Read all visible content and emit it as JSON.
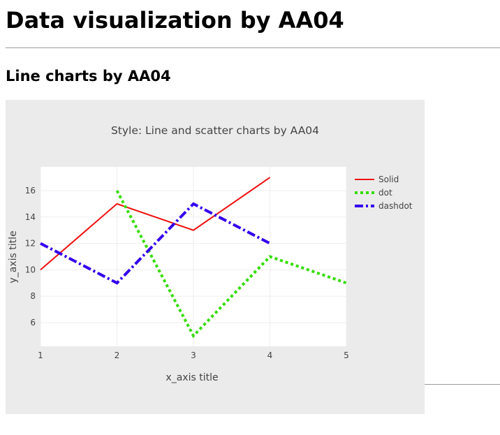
{
  "page": {
    "title": "Data visualization by AA04",
    "section_title": "Line charts by AA04"
  },
  "chart_data": {
    "type": "line",
    "title": "Style: Line and scatter charts by AA04",
    "xlabel": "x_axis title",
    "ylabel": "y_axis title",
    "xlim": [
      1,
      5
    ],
    "ylim": [
      4.2,
      17.8
    ],
    "x_ticks": [
      1,
      2,
      3,
      4,
      5
    ],
    "y_ticks": [
      6,
      8,
      10,
      12,
      14,
      16
    ],
    "grid": true,
    "legend_position": "top-right",
    "colors": {
      "paper_bg": "#ebebeb",
      "plot_bg": "#ffffff",
      "grid": "#eeeeee"
    },
    "series": [
      {
        "name": "Solid",
        "x": [
          1,
          2,
          3,
          4
        ],
        "y": [
          10,
          15,
          13,
          17
        ],
        "color": "#ee1111",
        "dash": "solid",
        "width": 2
      },
      {
        "name": "dot",
        "x": [
          2,
          3,
          4,
          5
        ],
        "y": [
          16,
          5,
          11,
          9
        ],
        "color": "#33dd00",
        "dash": "dot",
        "width": 4
      },
      {
        "name": "dashdot",
        "x": [
          1,
          2,
          3,
          4
        ],
        "y": [
          12,
          9,
          15,
          12
        ],
        "color": "#3300ee",
        "dash": "dashdot",
        "width": 4
      }
    ]
  }
}
